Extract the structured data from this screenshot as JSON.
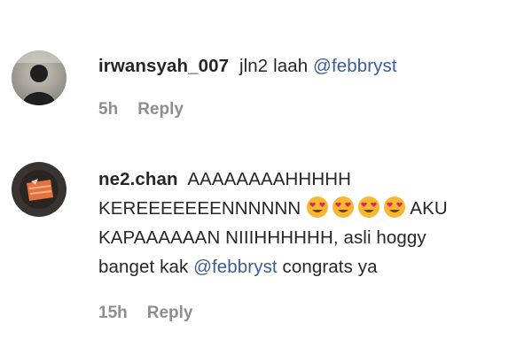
{
  "comments": [
    {
      "username": "irwansyah_007",
      "text_before": " jln2 laah ",
      "mention": "@febbryst",
      "time": "5h",
      "reply_label": "Reply"
    },
    {
      "username": "ne2.chan",
      "line1": " AAAAAAAAHHHHH",
      "line2": "KEREEEEEEENNNNNN",
      "emojis": [
        "heart-eyes-emoji",
        "heart-eyes-emoji",
        "heart-eyes-emoji",
        "heart-eyes-emoji"
      ],
      "line2_after": "AKU",
      "line3": "KAPAAAAAAN NIIIHHHHHH, asli hoggy",
      "line4_before": "banget kak ",
      "mention": "@febbryst",
      "line4_after": " congrats ya",
      "time": "15h",
      "reply_label": "Reply"
    }
  ],
  "colors": {
    "text": "#262626",
    "mention": "#3b5c95",
    "meta": "#8e8e8e",
    "emoji_face": "#f7b733",
    "emoji_heart": "#e0245e"
  }
}
